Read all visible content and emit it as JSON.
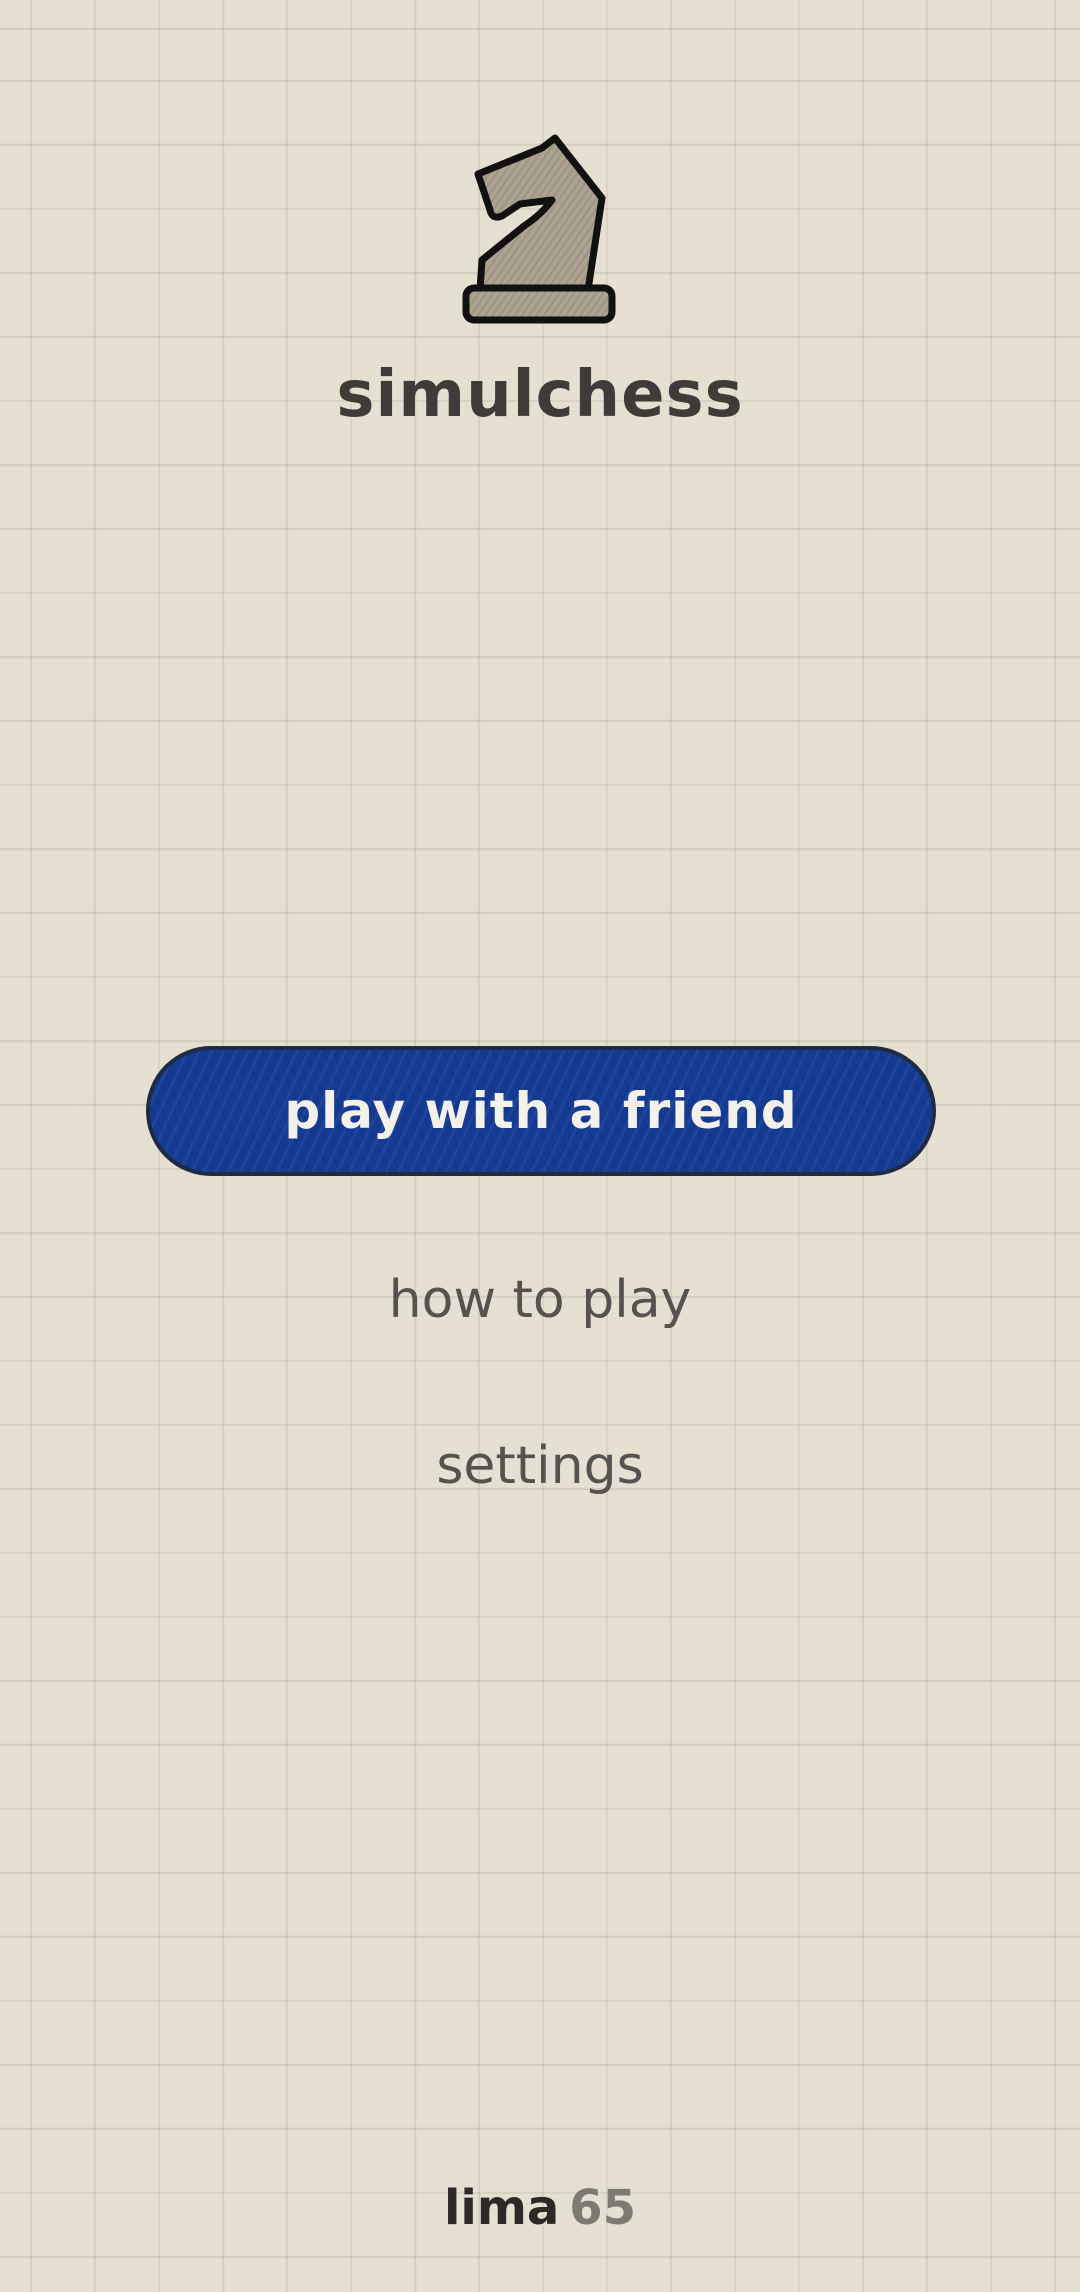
{
  "app": {
    "title": "simulchess",
    "logo_icon": "knight-icon"
  },
  "menu": {
    "primary_label": "play with a friend",
    "how_to_play_label": "how to play",
    "settings_label": "settings"
  },
  "version": {
    "name": "lima",
    "number": "65"
  },
  "colors": {
    "background": "#e6e0d2",
    "primary_button": "#143a94",
    "text": "#3e3c38",
    "knight_fill": "#aca392"
  }
}
